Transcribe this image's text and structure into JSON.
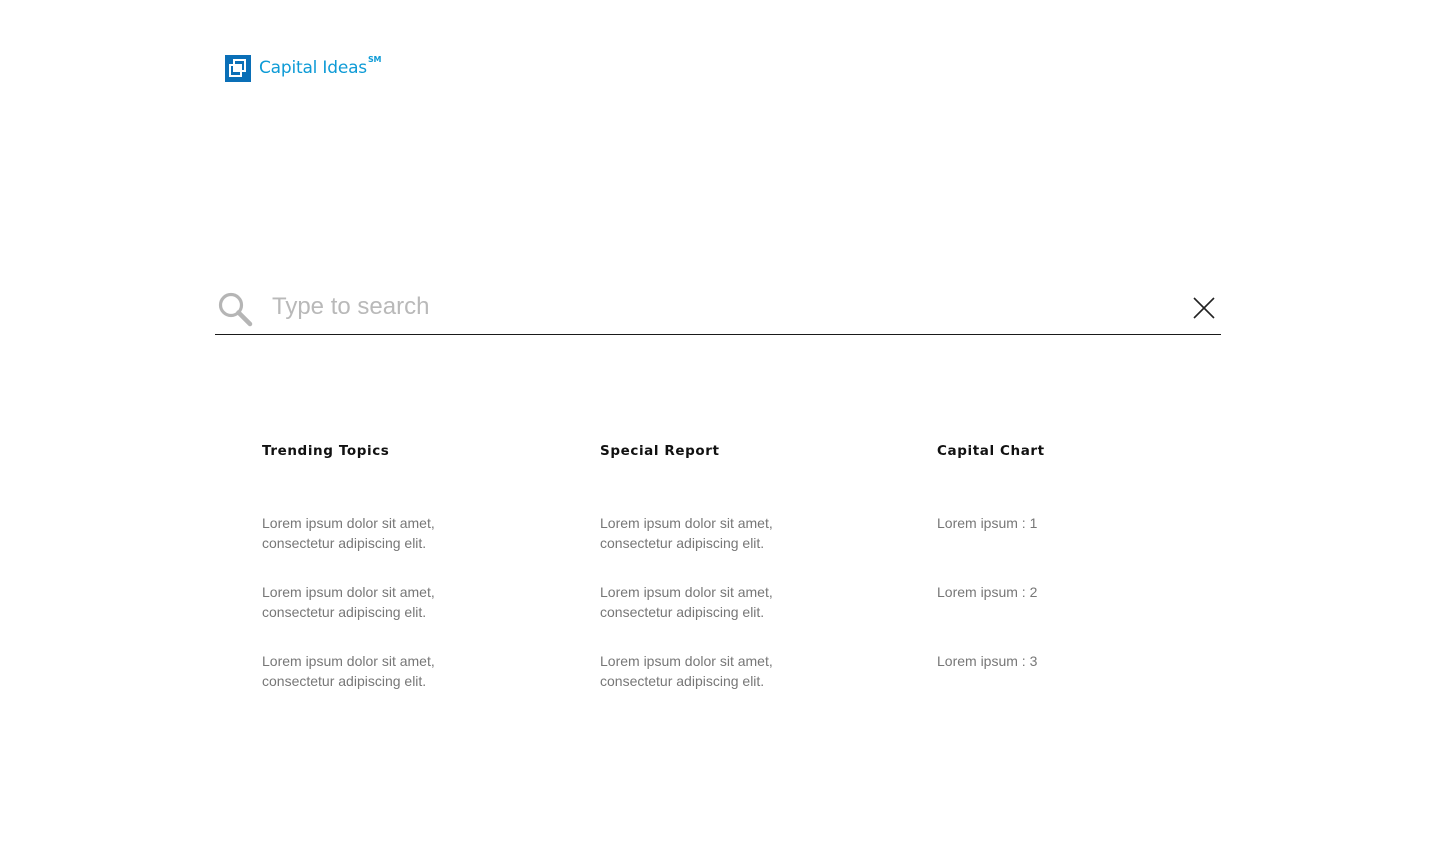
{
  "brand": {
    "name": "Capital Ideas",
    "mark": "SM",
    "color": "#0e9bd6",
    "icon": "capital-ideas-logo-icon"
  },
  "search": {
    "placeholder": "Type to search",
    "value": "",
    "icon": "search-icon",
    "close_icon": "close-icon"
  },
  "columns": [
    {
      "heading": "Trending Topics",
      "items": [
        {
          "line1": "Lorem ipsum dolor sit amet,",
          "line2": "consectetur adipiscing elit."
        },
        {
          "line1": "Lorem ipsum dolor sit amet,",
          "line2": "consectetur adipiscing elit."
        },
        {
          "line1": "Lorem ipsum dolor sit amet,",
          "line2": "consectetur adipiscing elit."
        }
      ]
    },
    {
      "heading": "Special Report",
      "items": [
        {
          "line1": "Lorem ipsum dolor sit amet,",
          "line2": "consectetur adipiscing elit."
        },
        {
          "line1": "Lorem ipsum dolor sit amet,",
          "line2": "consectetur adipiscing elit."
        },
        {
          "line1": "Lorem ipsum dolor sit amet,",
          "line2": "consectetur adipiscing elit."
        }
      ]
    },
    {
      "heading": "Capital Chart",
      "items": [
        {
          "line1": "Lorem ipsum : 1",
          "line2": ""
        },
        {
          "line1": "Lorem ipsum : 2",
          "line2": ""
        },
        {
          "line1": "Lorem ipsum : 3",
          "line2": ""
        }
      ]
    }
  ],
  "colors": {
    "heading": "#111111",
    "item_text": "#777777",
    "placeholder": "#b9b9b9",
    "divider": "#1a1a1a"
  }
}
